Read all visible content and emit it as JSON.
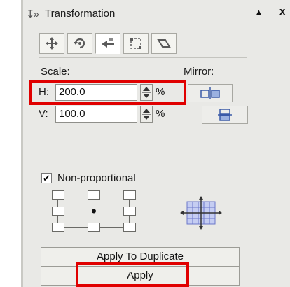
{
  "panel": {
    "grip_icon": "docker-grip-icon",
    "title": "Transformation",
    "collapse_icon": "triangle-up-icon",
    "close_icon": "close-icon"
  },
  "tabs": [
    {
      "name": "position",
      "icon": "move-arrows-icon"
    },
    {
      "name": "rotate",
      "icon": "rotate-icon"
    },
    {
      "name": "scale-mirror",
      "icon": "scale-mirror-icon",
      "active": true
    },
    {
      "name": "size",
      "icon": "size-icon"
    },
    {
      "name": "skew",
      "icon": "skew-icon"
    }
  ],
  "scale": {
    "label": "Scale:",
    "h_label": "H:",
    "h_value": "200.0",
    "v_label": "V:",
    "v_value": "100.0",
    "unit": "%"
  },
  "mirror": {
    "label": "Mirror:",
    "horizontal_icon": "mirror-horizontal-icon",
    "vertical_icon": "mirror-vertical-icon"
  },
  "non_proportional": {
    "label": "Non-proportional",
    "checked": true
  },
  "anchor": {
    "selected": "center"
  },
  "buttons": {
    "apply_to_duplicate": "Apply To Duplicate",
    "apply": "Apply"
  },
  "highlight_color": "#e00000"
}
